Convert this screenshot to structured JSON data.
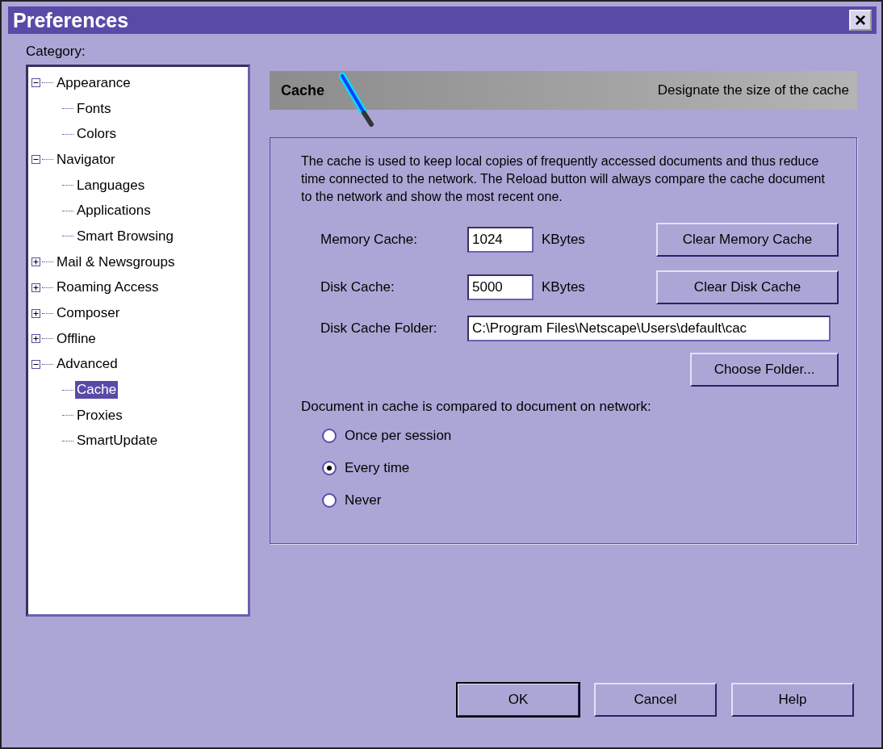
{
  "window": {
    "title": "Preferences",
    "close": "×"
  },
  "category_label": "Category:",
  "tree": [
    {
      "label": "Appearance",
      "expanded": true,
      "selected": false,
      "children": [
        {
          "label": "Fonts",
          "selected": false
        },
        {
          "label": "Colors",
          "selected": false
        }
      ]
    },
    {
      "label": "Navigator",
      "expanded": true,
      "selected": false,
      "children": [
        {
          "label": "Languages",
          "selected": false
        },
        {
          "label": "Applications",
          "selected": false
        },
        {
          "label": "Smart Browsing",
          "selected": false
        }
      ]
    },
    {
      "label": "Mail & Newsgroups",
      "expanded": false,
      "selected": false
    },
    {
      "label": "Roaming Access",
      "expanded": false,
      "selected": false
    },
    {
      "label": "Composer",
      "expanded": false,
      "selected": false
    },
    {
      "label": "Offline",
      "expanded": false,
      "selected": false
    },
    {
      "label": "Advanced",
      "expanded": true,
      "selected": false,
      "children": [
        {
          "label": "Cache",
          "selected": true
        },
        {
          "label": "Proxies",
          "selected": false
        },
        {
          "label": "SmartUpdate",
          "selected": false
        }
      ]
    }
  ],
  "header": {
    "title": "Cache",
    "subtitle": "Designate the size of the cache"
  },
  "description": "The cache is used to keep local copies of frequently accessed documents and thus reduce time connected to the network. The Reload button will always compare the cache document to the network and show the most recent one.",
  "fields": [
    {
      "kind": "size",
      "label": "Memory Cache:",
      "value": "1024",
      "unit": "KBytes",
      "button": "Clear Memory Cache"
    },
    {
      "kind": "size",
      "label": "Disk Cache:",
      "value": "5000",
      "unit": "KBytes",
      "button": "Clear Disk Cache"
    },
    {
      "kind": "folder",
      "label": "Disk Cache Folder:",
      "value": "C:\\Program Files\\Netscape\\Users\\default\\cac",
      "button": "Choose Folder..."
    }
  ],
  "compare_label": "Document in cache is compared to document on network:",
  "options": [
    {
      "label": "Once per session",
      "selected": false
    },
    {
      "label": "Every time",
      "selected": true
    },
    {
      "label": "Never",
      "selected": false
    }
  ],
  "buttons": [
    {
      "label": "OK",
      "default": true
    },
    {
      "label": "Cancel",
      "default": false
    },
    {
      "label": "Help",
      "default": false
    }
  ]
}
